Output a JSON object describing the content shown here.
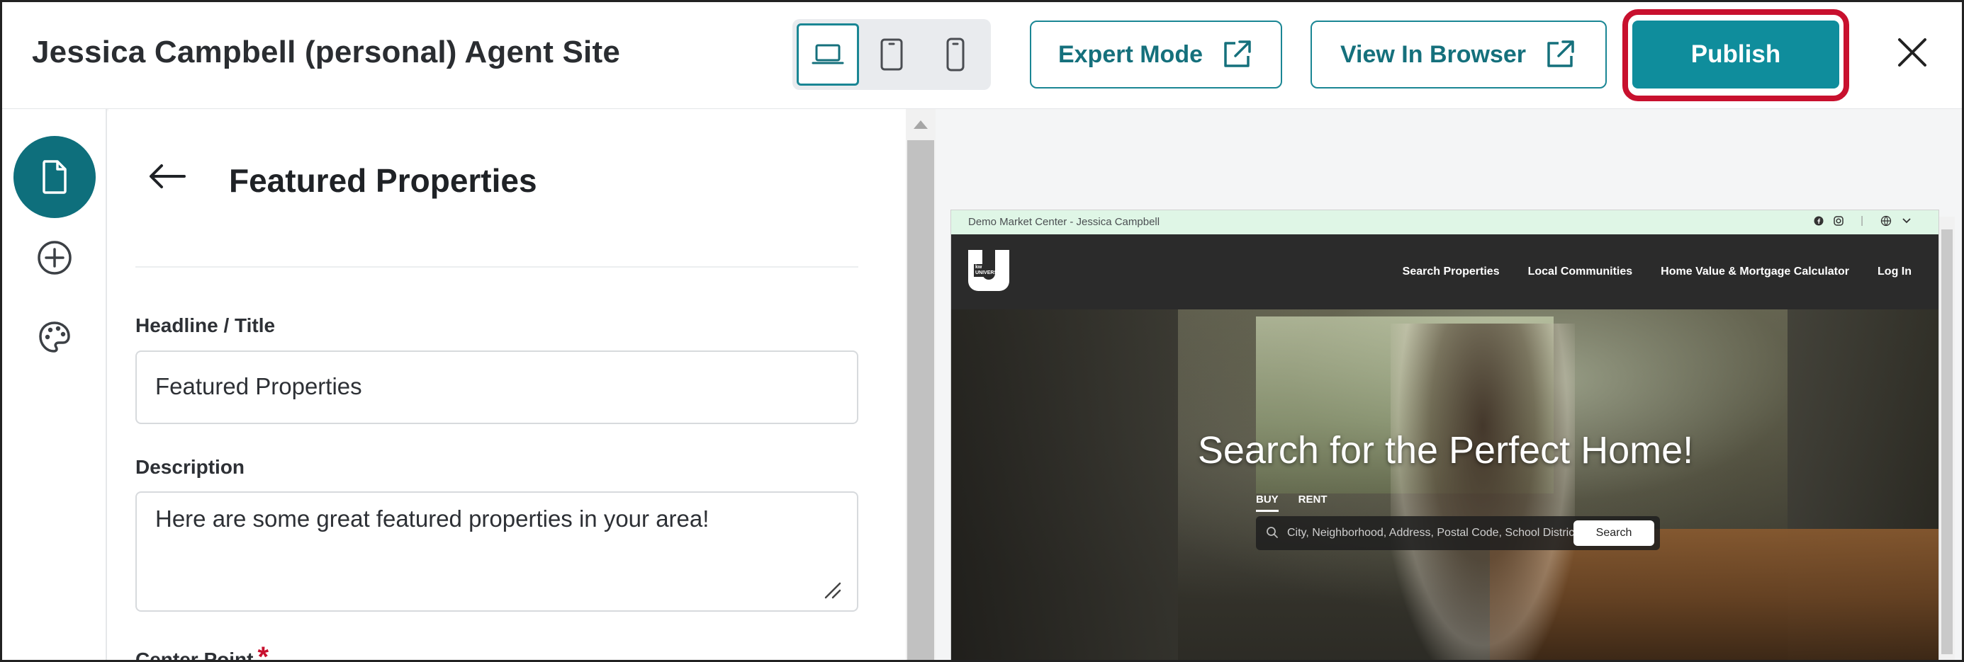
{
  "header": {
    "site_title": "Jessica Campbell (personal) Agent Site",
    "device_modes": [
      "desktop-icon",
      "tablet-icon",
      "mobile-icon"
    ],
    "active_device": "desktop",
    "expert_mode_label": "Expert Mode",
    "view_in_browser_label": "View In Browser",
    "publish_label": "Publish",
    "accent_color": "#0f8d9c",
    "highlight_color": "#c8102e"
  },
  "rail": {
    "items": [
      {
        "icon": "page-icon",
        "active": true
      },
      {
        "icon": "add-circle-icon",
        "active": false
      },
      {
        "icon": "palette-icon",
        "active": false
      }
    ]
  },
  "editor": {
    "title": "Featured Properties",
    "fields": {
      "headline_label": "Headline / Title",
      "headline_value": "Featured Properties",
      "description_label": "Description",
      "description_value": "Here are some great featured properties in your area!",
      "center_point_label": "Center Point",
      "required_mark": "*"
    }
  },
  "preview": {
    "market_center": "Demo Market Center - Jessica Campbell",
    "nav_items": [
      "Search Properties",
      "Local Communities",
      "Home Value & Mortgage Calculator",
      "Log In"
    ],
    "hero_title": "Search for the Perfect Home!",
    "tabs": [
      "BUY",
      "RENT"
    ],
    "search_placeholder": "City, Neighborhood, Address, Postal Code, School District",
    "search_button": "Search",
    "logo_text": "kw UNIVERSITY"
  }
}
